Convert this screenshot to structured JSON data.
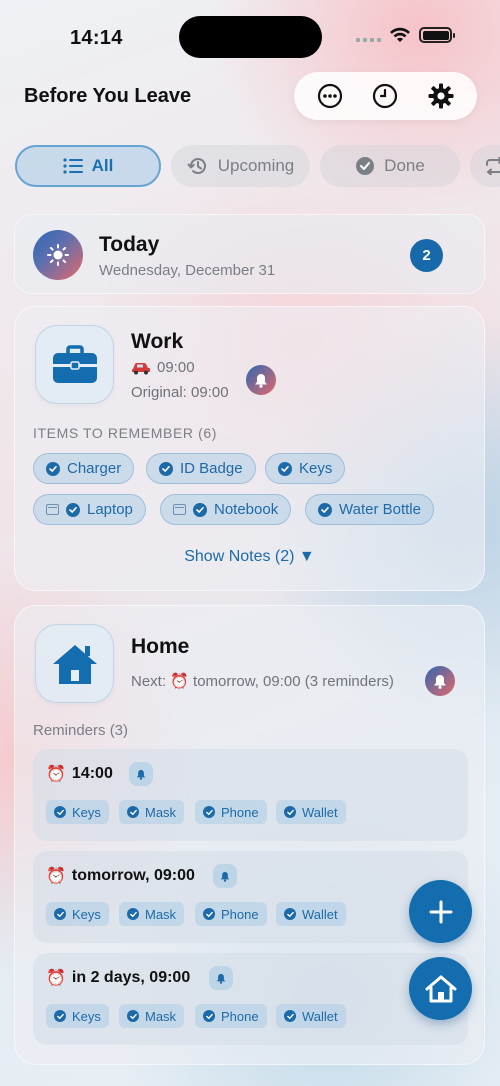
{
  "status": {
    "time": "14:14"
  },
  "header": {
    "title": "Before You Leave"
  },
  "toolbar": {
    "icons": [
      "more-icon",
      "history-icon",
      "gear-icon"
    ]
  },
  "filters": [
    {
      "label": "All",
      "icon": "list-icon",
      "active": true
    },
    {
      "label": "Upcoming",
      "icon": "history-icon",
      "active": false
    },
    {
      "label": "Done",
      "icon": "check-circle-icon",
      "active": false
    },
    {
      "label": "",
      "icon": "repeat-icon",
      "active": false
    }
  ],
  "today": {
    "title": "Today",
    "date": "Wednesday, December 31",
    "count": "2"
  },
  "work": {
    "title": "Work",
    "time": "09:00",
    "original": "Original: 09:00",
    "items_label": "ITEMS TO REMEMBER (6)",
    "items": [
      "Charger",
      "ID Badge",
      "Keys",
      "Laptop",
      "Notebook",
      "Water Bottle"
    ],
    "show_notes": "Show Notes (2) ▼"
  },
  "home": {
    "title": "Home",
    "next": "Next: ⏰ tomorrow, 09:00 (3 reminders)",
    "reminders_label": "Reminders (3)",
    "reminders": [
      {
        "time": "14:00",
        "items": [
          "Keys",
          "Mask",
          "Phone",
          "Wallet"
        ]
      },
      {
        "time": "tomorrow, 09:00",
        "items": [
          "Keys",
          "Mask",
          "Phone",
          "Wallet"
        ]
      },
      {
        "time": "in 2 days, 09:00",
        "items": [
          "Keys",
          "Mask",
          "Phone",
          "Wallet"
        ]
      }
    ]
  },
  "colors": {
    "accent": "#136dae",
    "text_secondary": "#7a7e86"
  }
}
